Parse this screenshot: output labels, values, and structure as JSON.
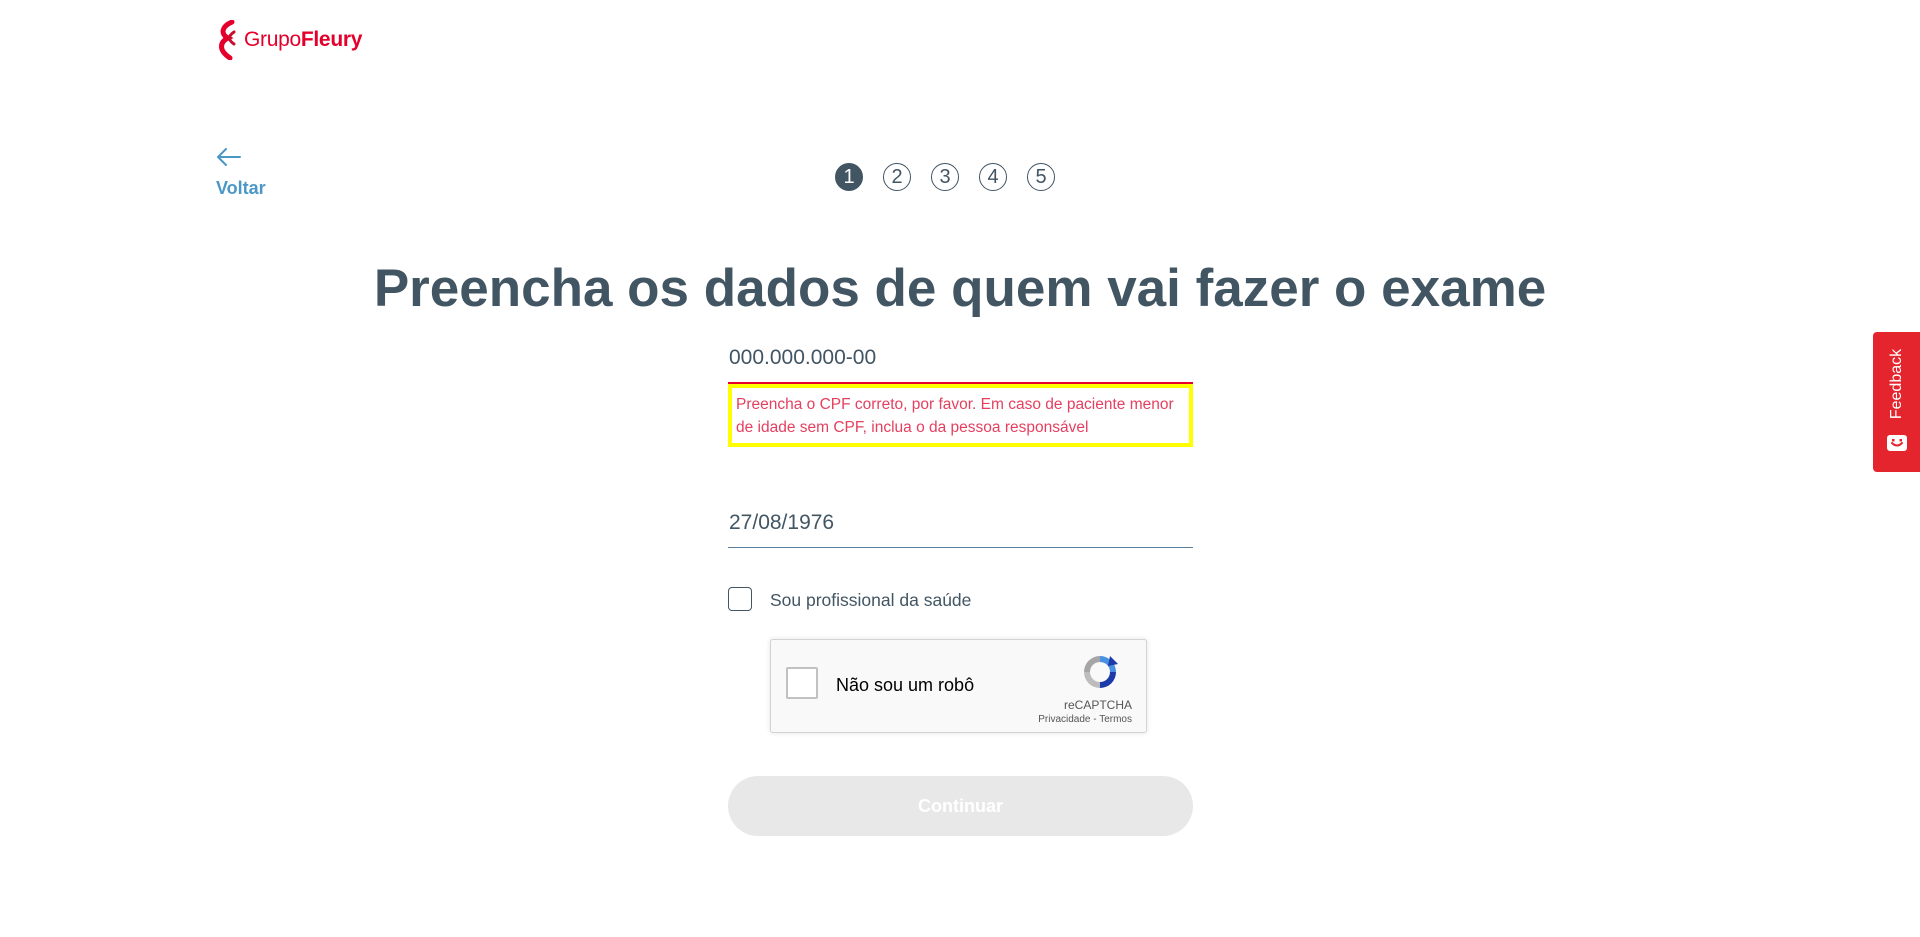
{
  "brand": {
    "logo_word1": "Grupo",
    "logo_word2": "Fleury",
    "color": "#e4002b"
  },
  "nav": {
    "back_label": "Voltar",
    "back_icon": "arrow-left-icon"
  },
  "stepper": {
    "steps": [
      "1",
      "2",
      "3",
      "4",
      "5"
    ],
    "active_step": 1
  },
  "page": {
    "title": "Preencha os dados de quem vai fazer o exame"
  },
  "form": {
    "cpf_value": "000.000.000-00",
    "cpf_error": "Preencha o CPF correto, por favor. Em caso de paciente menor de idade sem CPF, inclua o da pessoa responsável",
    "dob_value": "27/08/1976",
    "health_professional_label": "Sou profissional da saúde",
    "health_professional_checked": false
  },
  "recaptcha": {
    "label": "Não sou um robô",
    "brand": "reCAPTCHA",
    "privacy": "Privacidade",
    "separator": " - ",
    "terms": "Termos"
  },
  "actions": {
    "continue_label": "Continuar",
    "continue_enabled": false
  },
  "feedback": {
    "label": "Feedback",
    "color": "#e4252e"
  },
  "colors": {
    "text": "#425563",
    "link": "#4b98c7",
    "error": "#e4405f",
    "highlight": "#ffff00"
  }
}
